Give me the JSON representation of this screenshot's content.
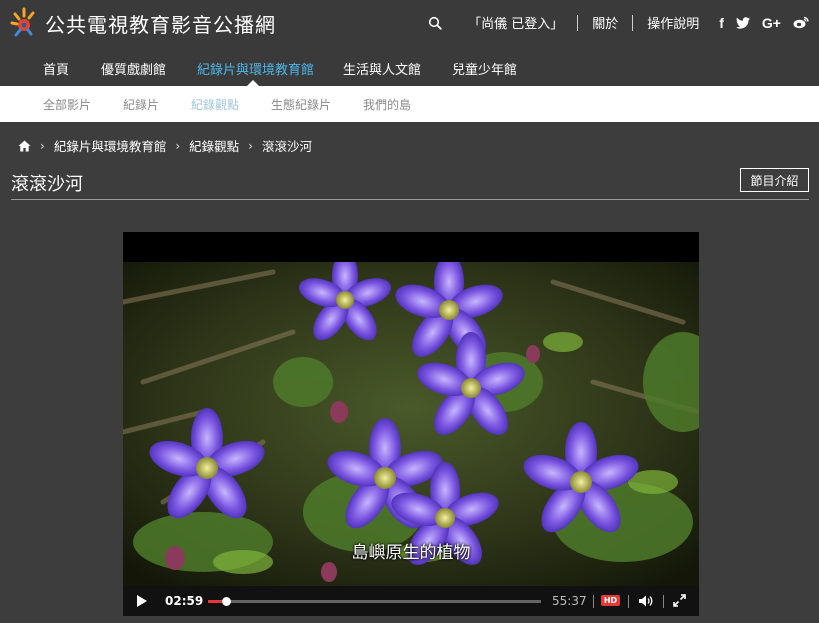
{
  "site": {
    "title": "公共電視教育影音公播網"
  },
  "header": {
    "user_status": "「尚儀 已登入」",
    "about": "關於",
    "help": "操作說明",
    "icons": [
      "search-icon",
      "facebook-icon",
      "twitter-icon",
      "google-plus-icon",
      "weibo-icon"
    ],
    "social": {
      "facebook": "f",
      "google_plus": "G+"
    }
  },
  "main_nav": {
    "items": [
      {
        "label": "首頁",
        "active": false
      },
      {
        "label": "優質戲劇館",
        "active": false
      },
      {
        "label": "紀錄片與環境教育館",
        "active": true
      },
      {
        "label": "生活與人文館",
        "active": false
      },
      {
        "label": "兒童少年館",
        "active": false
      }
    ]
  },
  "sub_nav": {
    "items": [
      {
        "label": "全部影片",
        "active": false
      },
      {
        "label": "紀錄片",
        "active": false
      },
      {
        "label": "紀錄觀點",
        "active": true
      },
      {
        "label": "生態紀錄片",
        "active": false
      },
      {
        "label": "我們的島",
        "active": false
      }
    ]
  },
  "breadcrumb": {
    "items": [
      "紀錄片與環境教育館",
      "紀錄觀點",
      "滾滾沙河"
    ]
  },
  "page": {
    "title": "滾滾沙河",
    "intro_button": "節目介紹"
  },
  "player": {
    "subtitle": "島嶼原生的植物",
    "current_time": "02:59",
    "total_time": "55:37",
    "progress": 0.054,
    "hd_label": "HD"
  },
  "colors": {
    "background": "#3d3d3d",
    "nav_active": "#4db6e8",
    "sub_active": "#9fc5d9",
    "accent_red": "#e53935"
  }
}
